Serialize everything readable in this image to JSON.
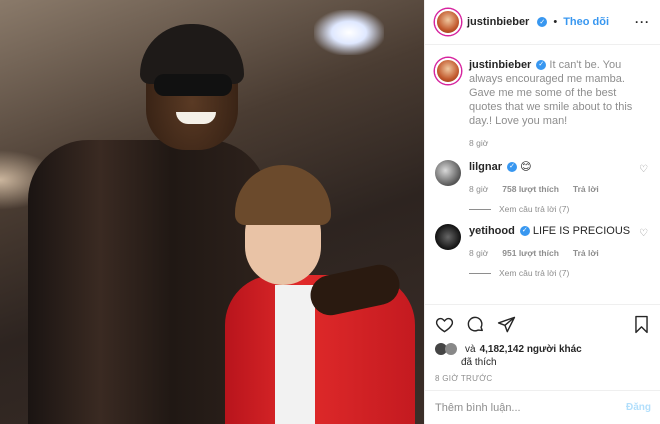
{
  "header": {
    "username": "justinbieber",
    "separator": "•",
    "follow_label": "Theo dõi",
    "more_icon": "ellipsis-icon"
  },
  "caption": {
    "username": "justinbieber",
    "text": "It can't be. You always encouraged me mamba. Gave me me some of the best quotes that we smile about to this day.! Love you man!",
    "time": "8 giờ"
  },
  "comments": [
    {
      "username": "lilgnar",
      "text": "😊",
      "time": "8 giờ",
      "likes": "758 lượt thích",
      "reply_label": "Trả lời",
      "view_replies": "Xem câu trả lời (7)"
    },
    {
      "username": "yetihood",
      "text": "LIFE IS PRECIOUS",
      "time": "8 giờ",
      "likes": "951 lượt thích",
      "reply_label": "Trả lời",
      "view_replies": "Xem câu trả lời (7)"
    }
  ],
  "likes": {
    "prefix": "và",
    "count": "4,182,142 người khác",
    "suffix": "đã thích"
  },
  "posted_ago": "8 GIỜ TRƯỚC",
  "comment_box": {
    "placeholder": "Thêm bình luận...",
    "post_label": "Đăng"
  },
  "colors": {
    "accent": "#3897f0",
    "muted": "#8e8e8e"
  }
}
